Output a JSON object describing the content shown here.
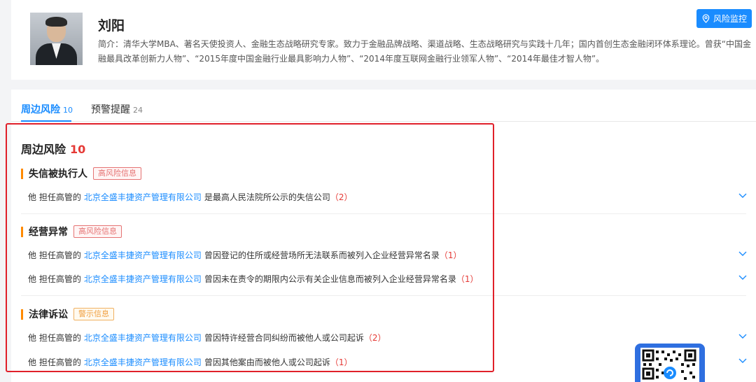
{
  "profile": {
    "name": "刘阳",
    "bio": "简介：清华大学MBA、著名天使投资人、金融生态战略研究专家。致力于金融品牌战略、渠道战略、生态战略研究与实践十几年；国内首创生态金融闭环体系理论。曾获“中国金融最具改革创新力人物”、“2015年度中国金融行业最具影响力人物”、“2014年度互联网金融行业领军人物”、“2014年最佳才智人物”。",
    "monitor_label": "风险监控"
  },
  "tabs": [
    {
      "label": "周边风险",
      "count": "10"
    },
    {
      "label": "预警提醒",
      "count": "24"
    }
  ],
  "risk": {
    "title": "周边风险",
    "count": "10",
    "sections": [
      {
        "label": "失信被执行人",
        "tag": "高风险信息",
        "rows": [
          {
            "prefix": "他 担任高管的",
            "company": "北京全盛丰捷资产管理有限公司",
            "text": "是最高人民法院所公示的失信公司",
            "count": "（2）"
          }
        ]
      },
      {
        "label": "经营异常",
        "tag": "高风险信息",
        "rows": [
          {
            "prefix": "他 担任高管的",
            "company": "北京全盛丰捷资产管理有限公司",
            "text": "曾因登记的住所或经营场所无法联系而被列入企业经营异常名录",
            "count": "（1）"
          },
          {
            "prefix": "他 担任高管的",
            "company": "北京全盛丰捷资产管理有限公司",
            "text": "曾因未在责令的期限内公示有关企业信息而被列入企业经营异常名录",
            "count": "（1）"
          }
        ]
      },
      {
        "label": "法律诉讼",
        "tag": "警示信息",
        "rows": [
          {
            "prefix": "他 担任高管的",
            "company": "北京全盛丰捷资产管理有限公司",
            "text": "曾因特许经营合同纠纷而被他人或公司起诉",
            "count": "（2）"
          },
          {
            "prefix": "他 担任高管的",
            "company": "北京全盛丰捷资产管理有限公司",
            "text": "曾因其他案由而被他人或公司起诉",
            "count": "（1）"
          }
        ]
      }
    ]
  },
  "colors": {
    "accent": "#1a8cff",
    "danger": "#e53935",
    "warning": "#ff8a00",
    "highlight_border": "#e0202a"
  }
}
